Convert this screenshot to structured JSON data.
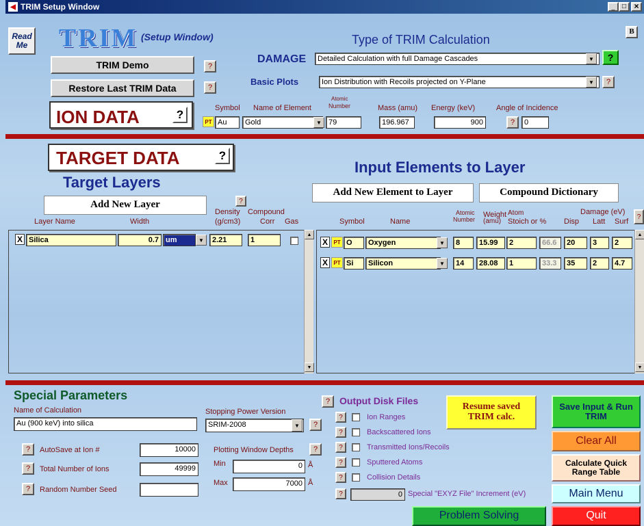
{
  "window": {
    "title": "TRIM Setup Window",
    "min": "_",
    "max": "□",
    "close": "×"
  },
  "header": {
    "read_me": "Read Me",
    "logo": "TRIM",
    "subtitle": "(Setup Window)",
    "b_button": "B",
    "demo_button": "TRIM Demo",
    "restore_button": "Restore Last TRIM Data",
    "help": "?"
  },
  "calc": {
    "type_title": "Type of TRIM Calculation",
    "damage_label": "DAMAGE",
    "damage_value": "Detailed Calculation with full Damage Cascades",
    "basic_plots_label": "Basic Plots",
    "basic_plots_value": "Ion Distribution with Recoils projected on Y-Plane"
  },
  "ion": {
    "title": "ION DATA",
    "col_symbol": "Symbol",
    "col_name": "Name of Element",
    "col_atomic1": "Atomic",
    "col_atomic2": "Number",
    "col_mass": "Mass (amu)",
    "col_energy": "Energy (keV)",
    "col_angle": "Angle of Incidence",
    "pt": "PT",
    "symbol": "Au",
    "name": "Gold",
    "atomic": "79",
    "mass": "196.967",
    "energy": "900",
    "angle": "0"
  },
  "target": {
    "title": "TARGET DATA",
    "layers_title": "Target Layers",
    "add_layer": "Add New Layer",
    "col_layer_name": "Layer Name",
    "col_width": "Width",
    "col_density1": "Density",
    "col_density2": "(g/cm3)",
    "col_compound1": "Compound",
    "col_corr": "Corr",
    "col_gas": "Gas",
    "layers": [
      {
        "x": "X",
        "name": "Silica",
        "width": "0.7",
        "unit": "um",
        "density": "2.21",
        "corr": "1"
      }
    ]
  },
  "elements": {
    "title": "Input Elements to Layer",
    "add_element": "Add New Element to Layer",
    "compound_dict": "Compound Dictionary",
    "col_symbol": "Symbol",
    "col_name": "Name",
    "col_atomic1": "Atomic",
    "col_atomic2": "Number",
    "col_weight1": "Weight",
    "col_weight2": "(amu)",
    "col_atom": "Atom",
    "col_stoich": "Stoich or %",
    "col_damage": "Damage (eV)",
    "col_disp": "Disp",
    "col_latt": "Latt",
    "col_surf": "Surf",
    "rows": [
      {
        "x": "X",
        "pt": "PT",
        "symbol": "O",
        "name": "Oxygen",
        "atomic": "8",
        "weight": "15.99",
        "stoich": "2",
        "pct": "66.6",
        "disp": "20",
        "latt": "3",
        "surf": "2"
      },
      {
        "x": "X",
        "pt": "PT",
        "symbol": "Si",
        "name": "Silicon",
        "atomic": "14",
        "weight": "28.08",
        "stoich": "1",
        "pct": "33.3",
        "disp": "35",
        "latt": "2",
        "surf": "4.7"
      }
    ]
  },
  "special": {
    "title": "Special Parameters",
    "calc_name_label": "Name of Calculation",
    "calc_name": "Au (900 keV) into silica",
    "stopping_label": "Stopping Power Version",
    "stopping_value": "SRIM-2008",
    "autosave_label": "AutoSave at Ion #",
    "autosave": "10000",
    "total_label": "Total Number of Ions",
    "total": "49999",
    "seed_label": "Random Number Seed",
    "seed": "",
    "plot_depths_label": "Plotting Window Depths",
    "min_label": "Min",
    "min": "0",
    "max_label": "Max",
    "max": "7000",
    "unit": "Å"
  },
  "output": {
    "title": "Output Disk Files",
    "items": [
      "Ion Ranges",
      "Backscattered Ions",
      "Transmitted Ions/Recoils",
      "Sputtered Atoms",
      "Collision Details"
    ],
    "exyz_value": "0",
    "exyz_label": "Special \"EXYZ File\" Increment (eV)"
  },
  "actions": {
    "resume": "Resume saved TRIM calc.",
    "save_run": "Save Input & Run TRIM",
    "clear": "Clear All",
    "quick_range": "Calculate Quick Range Table",
    "main_menu": "Main Menu",
    "problem": "Problem Solving",
    "quit": "Quit"
  },
  "colors": {
    "title_bar": "#0a246a",
    "red_bar": "#b01010",
    "green": "#33cc33",
    "orange": "#ff9933",
    "red": "#ff2020",
    "yellow": "#ffff33"
  }
}
